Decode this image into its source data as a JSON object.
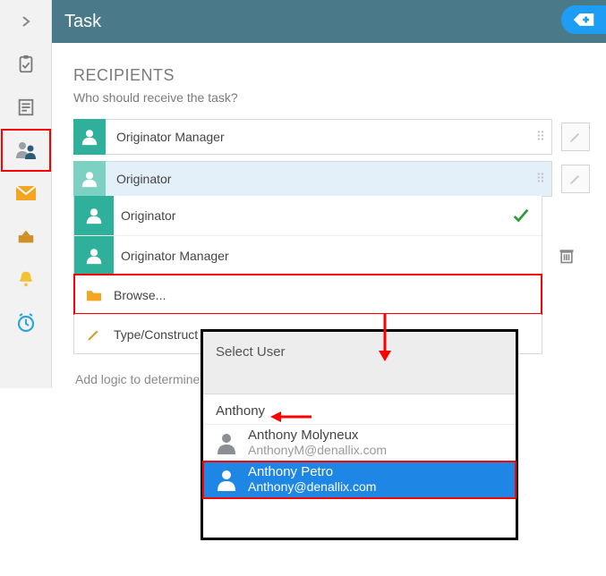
{
  "header": {
    "title": "Task"
  },
  "section": {
    "title": "RECIPIENTS",
    "subtitle": "Who should receive the task?"
  },
  "recipients": {
    "row0": "Originator Manager",
    "row1": "Originator"
  },
  "dropdown": {
    "item0": "Originator",
    "item1": "Originator Manager",
    "browse": "Browse...",
    "construct": "Type/Construct my own value"
  },
  "hint": "Add logic to determine",
  "popup": {
    "title": "Select User",
    "search_value": "Anthony",
    "results": {
      "r0_name": "Anthony Molyneux",
      "r0_email": "AnthonyM@denallix.com",
      "r1_name": "Anthony Petro",
      "r1_email": "Anthony@denallix.com"
    }
  },
  "colors": {
    "header_bg": "#4a7989",
    "accent_blue": "#1e9df4",
    "avatar_teal": "#2fb09a",
    "selection_blue": "#1e87e5",
    "highlight_red": "#f00"
  }
}
